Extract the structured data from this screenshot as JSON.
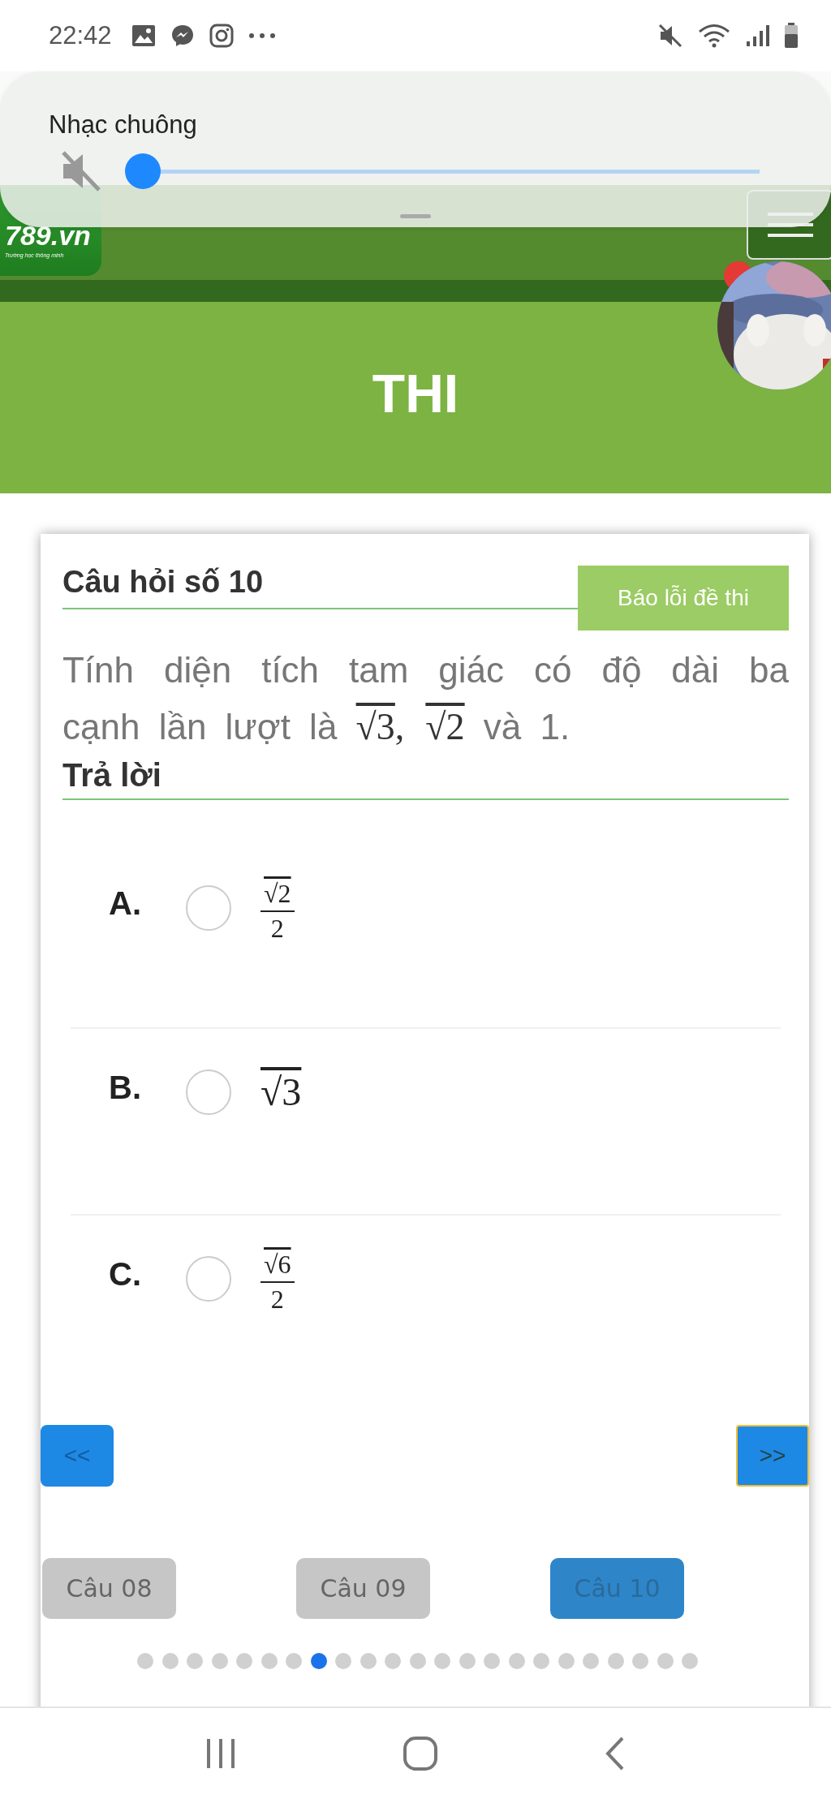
{
  "status_bar": {
    "time": "22:42"
  },
  "volume_popup": {
    "label": "Nhạc chuông",
    "muted": true,
    "level": 0
  },
  "site_header": {
    "logo": "789.vn",
    "logo_tagline": "Trường học thông minh"
  },
  "page_title": "THI",
  "question": {
    "heading": "Câu hỏi số 10",
    "report_button": "Báo lỗi đề thi",
    "segments": [
      {
        "kind": "text",
        "text": "Tính diện tích tam giác có độ dài ba cạnh lần lượt là "
      },
      {
        "kind": "sqrt",
        "text": "√3"
      },
      {
        "kind": "math",
        "text": ","
      },
      {
        "kind": "sqrt",
        "text": "√2"
      },
      {
        "kind": "text",
        "text": " và 1."
      }
    ],
    "answer_heading": "Trả lời",
    "answers": [
      {
        "letter": "A.",
        "selected": false,
        "kind": "fraction",
        "numerator": "√2",
        "denominator": "2"
      },
      {
        "letter": "B.",
        "selected": false,
        "kind": "sqrt",
        "value": "√3"
      },
      {
        "letter": "C.",
        "selected": false,
        "kind": "fraction",
        "numerator": "√6",
        "denominator": "2"
      }
    ]
  },
  "nav": {
    "prev": "<<",
    "next": ">>",
    "next_focused": true
  },
  "question_buttons": [
    {
      "label": "Câu 08",
      "selected": false
    },
    {
      "label": "Câu 09",
      "selected": false
    },
    {
      "label": "Câu 10",
      "selected": true
    }
  ],
  "pager_dots": [
    {
      "selected": false
    },
    {
      "selected": false
    },
    {
      "selected": false
    },
    {
      "selected": false
    },
    {
      "selected": false
    },
    {
      "selected": false
    },
    {
      "selected": false
    },
    {
      "selected": true
    },
    {
      "selected": false
    },
    {
      "selected": false
    },
    {
      "selected": false
    },
    {
      "selected": false
    },
    {
      "selected": false
    },
    {
      "selected": false
    },
    {
      "selected": false
    },
    {
      "selected": false
    },
    {
      "selected": false
    },
    {
      "selected": false
    },
    {
      "selected": false
    },
    {
      "selected": false
    },
    {
      "selected": false
    },
    {
      "selected": false
    },
    {
      "selected": false
    }
  ]
}
